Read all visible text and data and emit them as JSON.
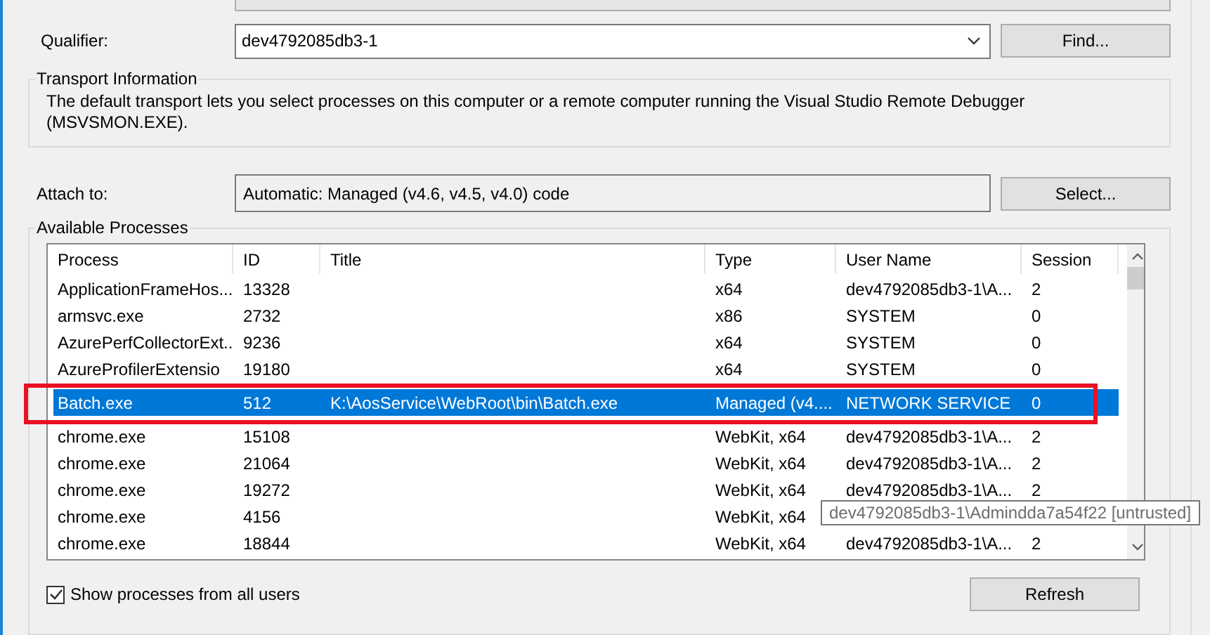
{
  "qualifier": {
    "label": "Qualifier:",
    "value": "dev4792085db3-1",
    "button": "Find..."
  },
  "transport": {
    "title": "Transport Information",
    "text": "The default transport lets you select processes on this computer or a remote computer running the Visual Studio Remote Debugger (MSVSMON.EXE)."
  },
  "attach": {
    "label": "Attach to:",
    "value": "Automatic: Managed (v4.6, v4.5, v4.0) code",
    "button": "Select..."
  },
  "processes": {
    "title": "Available Processes",
    "columns": [
      "Process",
      "ID",
      "Title",
      "Type",
      "User Name",
      "Session"
    ],
    "rows": [
      {
        "process": "ApplicationFrameHos...",
        "id": "13328",
        "title": "",
        "type": "x64",
        "user_name": "dev4792085db3-1\\A...",
        "session": "2",
        "selected": false
      },
      {
        "process": "armsvc.exe",
        "id": "2732",
        "title": "",
        "type": "x86",
        "user_name": "SYSTEM",
        "session": "0",
        "selected": false
      },
      {
        "process": "AzurePerfCollectorExt...",
        "id": "9236",
        "title": "",
        "type": "x64",
        "user_name": "SYSTEM",
        "session": "0",
        "selected": false
      },
      {
        "process": "AzureProfilerExtensio",
        "id": "19180",
        "title": "",
        "type": "x64",
        "user_name": "SYSTEM",
        "session": "0",
        "selected": false
      },
      {
        "process": "Batch.exe",
        "id": "512",
        "title": "K:\\AosService\\WebRoot\\bin\\Batch.exe",
        "type": "Managed (v4....",
        "user_name": "NETWORK SERVICE",
        "session": "0",
        "selected": true
      },
      {
        "process": "chrome.exe",
        "id": "15108",
        "title": "",
        "type": "WebKit, x64",
        "user_name": "dev4792085db3-1\\A...",
        "session": "2",
        "selected": false
      },
      {
        "process": "chrome.exe",
        "id": "21064",
        "title": "",
        "type": "WebKit, x64",
        "user_name": "dev4792085db3-1\\A...",
        "session": "2",
        "selected": false
      },
      {
        "process": "chrome.exe",
        "id": "19272",
        "title": "",
        "type": "WebKit, x64",
        "user_name": "dev4792085db3-1\\A...",
        "session": "2",
        "selected": false
      },
      {
        "process": "chrome.exe",
        "id": "4156",
        "title": "",
        "type": "WebKit, x64",
        "selected": false
      },
      {
        "process": "chrome.exe",
        "id": "18844",
        "title": "",
        "type": "WebKit, x64",
        "user_name": "dev4792085db3-1\\A...",
        "session": "2",
        "selected": false
      }
    ],
    "tooltip": "dev4792085db3-1\\Admindda7a54f22 [untrusted]",
    "show_all_users": {
      "label": "Show processes from all users",
      "checked": true
    },
    "refresh": "Refresh"
  }
}
